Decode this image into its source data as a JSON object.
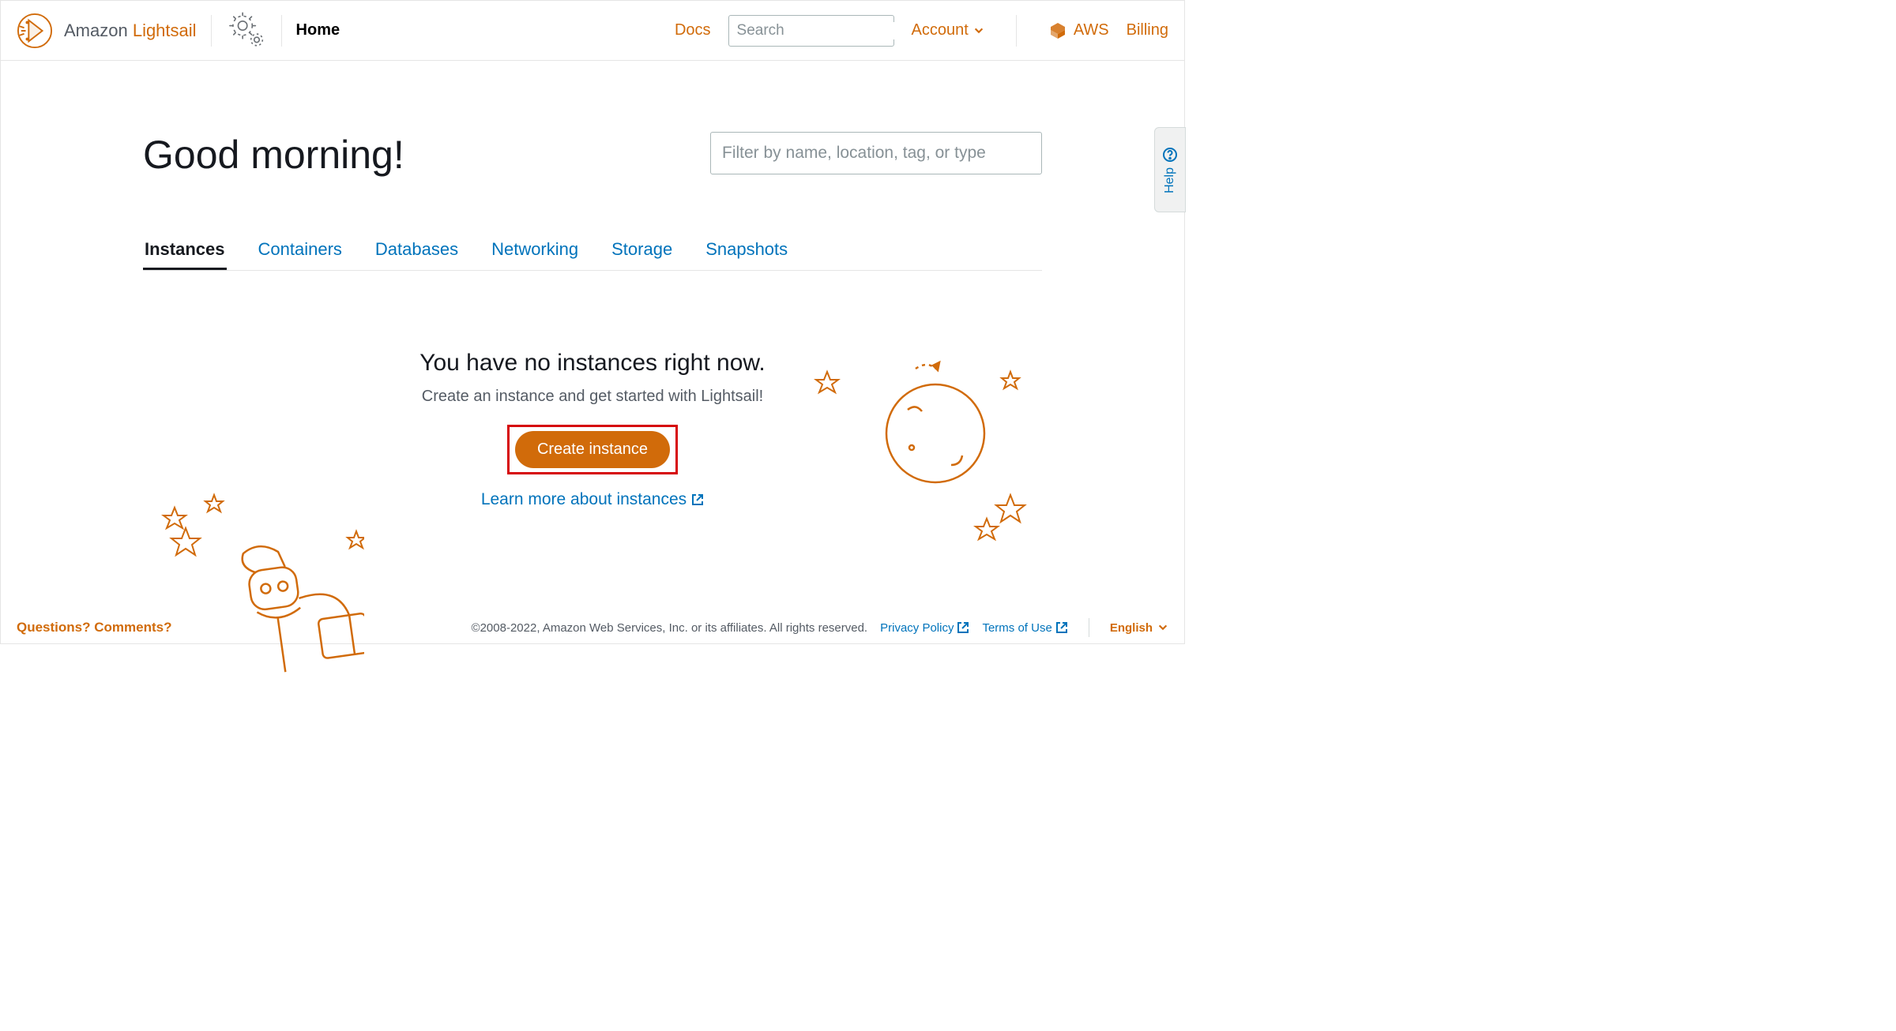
{
  "header": {
    "brand_prefix": "Amazon ",
    "brand_accent": "Lightsail",
    "home_label": "Home",
    "docs_label": "Docs",
    "search_placeholder": "Search",
    "account_label": "Account",
    "aws_label": "AWS",
    "billing_label": "Billing"
  },
  "main": {
    "greeting": "Good morning!",
    "filter_placeholder": "Filter by name, location, tag, or type",
    "tabs": [
      "Instances",
      "Containers",
      "Databases",
      "Networking",
      "Storage",
      "Snapshots"
    ],
    "active_tab": "Instances",
    "empty_title": "You have no instances right now.",
    "empty_sub": "Create an instance and get started with Lightsail!",
    "create_label": "Create instance",
    "learn_label": "Learn more about instances"
  },
  "help": {
    "label": "Help"
  },
  "footer": {
    "questions": "Questions? Comments?",
    "copyright": "©2008-2022, Amazon Web Services, Inc. or its affiliates. All rights reserved.",
    "privacy": "Privacy Policy",
    "terms": "Terms of Use",
    "language": "English"
  },
  "colors": {
    "accent": "#d16b0a",
    "link": "#0073bb"
  }
}
